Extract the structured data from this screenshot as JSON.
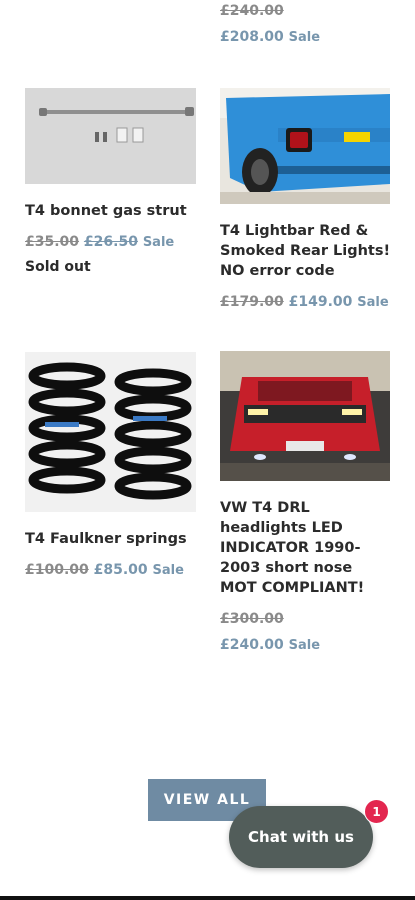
{
  "products": [
    {
      "title": "",
      "compare_price": "£240.00",
      "price": "£208.00",
      "sale_label": "Sale",
      "image_icon": "product-image"
    },
    {
      "title": "T4 bonnet gas strut",
      "compare_price": "£35.00",
      "price": "£26.50",
      "sale_label": "Sale",
      "sold_out_label": "Sold out",
      "image_icon": "gas-strut-photo"
    },
    {
      "title_lines": [
        "T4 Lightbar Red &",
        "Smoked Rear Lights!",
        "NO error code"
      ],
      "compare_price": "£179.00",
      "price": "£149.00",
      "sale_label": "Sale",
      "image_icon": "blue-van-rear-lights-photo"
    },
    {
      "title": "T4 Faulkner springs",
      "compare_price": "£100.00",
      "price": "£85.00",
      "sale_label": "Sale",
      "image_icon": "coil-springs-photo"
    },
    {
      "title_lines": [
        "VW T4 DRL",
        "headlights LED",
        "INDICATOR 1990-",
        "2003 short nose",
        "MOT COMPLIANT!"
      ],
      "compare_price": "£300.00",
      "price": "£240.00",
      "sale_label": "Sale",
      "image_icon": "red-van-headlights-photo"
    }
  ],
  "view_all_label": "VIEW ALL",
  "chat": {
    "label": "Chat with us",
    "badge_count": "1"
  },
  "colors": {
    "sale_accent": "#7896ad",
    "button_bg": "#6f8ba3",
    "chat_bg": "#525d5a",
    "badge_bg": "#e3264f"
  }
}
